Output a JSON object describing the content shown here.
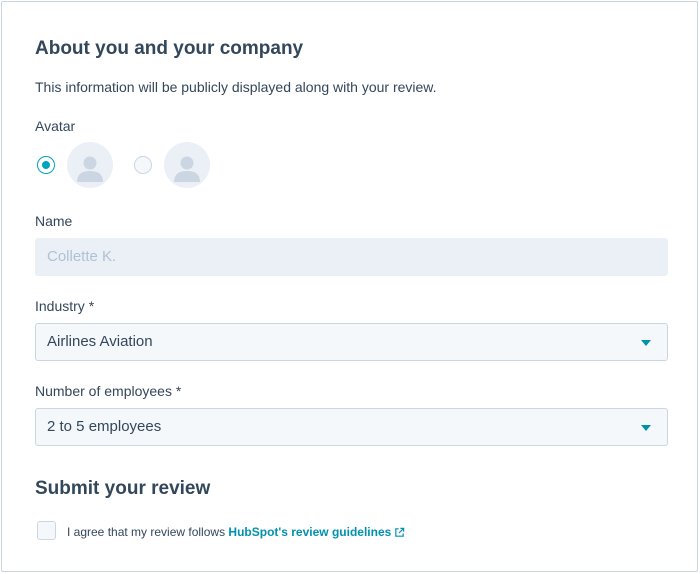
{
  "about": {
    "title": "About you and your company",
    "description": "This information will be publicly displayed along with your review."
  },
  "avatar": {
    "label": "Avatar",
    "options": [
      {
        "selected": true,
        "icon": "person-avatar-icon"
      },
      {
        "selected": false,
        "icon": "person-avatar-icon"
      }
    ]
  },
  "name": {
    "label": "Name",
    "value": "Collette K."
  },
  "industry": {
    "label": "Industry *",
    "value": "Airlines Aviation"
  },
  "employees": {
    "label": "Number of employees *",
    "value": "2 to 5 employees"
  },
  "submit": {
    "title": "Submit your review",
    "agree_text": "I agree that my review follows ",
    "guidelines_link": "HubSpot's review guidelines",
    "link_icon": "external-link-icon"
  },
  "colors": {
    "accent": "#00a4bd",
    "link": "#0091ae",
    "text": "#33475b"
  }
}
